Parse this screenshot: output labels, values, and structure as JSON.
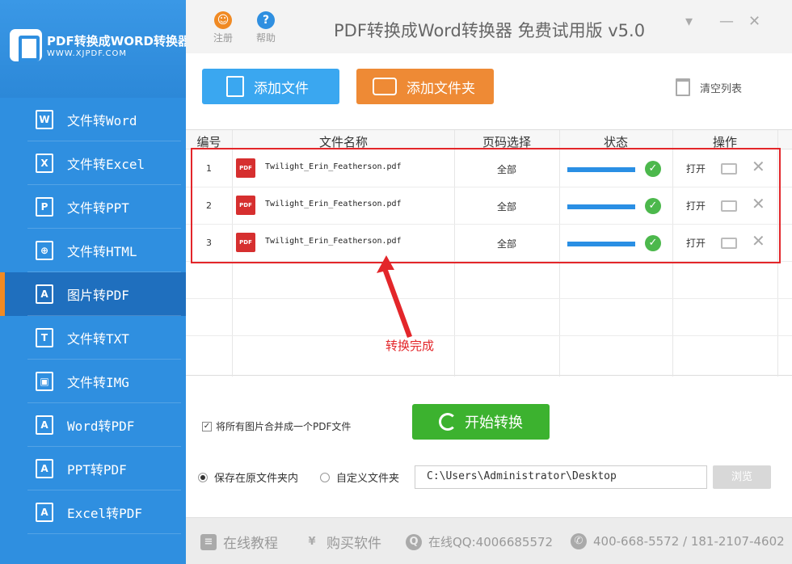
{
  "app": {
    "logo_title": "PDF转换成WORD转换器",
    "logo_sub": "WWW.XJPDF.COM",
    "title": "PDF转换成Word转换器 免费试用版 v5.0"
  },
  "topbar": {
    "register_label": "注册",
    "help_label": "帮助",
    "minimize": "▾",
    "min_bar": "—",
    "close": "✕"
  },
  "sidebar": {
    "items": [
      {
        "label": "文件转Word",
        "icon": "W",
        "active": false
      },
      {
        "label": "文件转Excel",
        "icon": "X",
        "active": false
      },
      {
        "label": "文件转PPT",
        "icon": "P",
        "active": false
      },
      {
        "label": "文件转HTML",
        "icon": "⊕",
        "active": false
      },
      {
        "label": "图片转PDF",
        "icon": "A",
        "active": true
      },
      {
        "label": "文件转TXT",
        "icon": "T",
        "active": false
      },
      {
        "label": "文件转IMG",
        "icon": "▣",
        "active": false
      },
      {
        "label": "Word转PDF",
        "icon": "A",
        "active": false
      },
      {
        "label": "PPT转PDF",
        "icon": "A",
        "active": false
      },
      {
        "label": "Excel转PDF",
        "icon": "A",
        "active": false
      }
    ]
  },
  "toolbar": {
    "add_file": "添加文件",
    "add_folder": "添加文件夹",
    "clear_list": "清空列表"
  },
  "table": {
    "headers": [
      "编号",
      "文件名称",
      "页码选择",
      "状态",
      "操作"
    ],
    "rows": [
      {
        "num": "1",
        "file": "Twilight_Erin_Featherson.pdf",
        "pages": "全部",
        "progress": 1.0,
        "action": "打开"
      },
      {
        "num": "2",
        "file": "Twilight_Erin_Featherson.pdf",
        "pages": "全部",
        "progress": 1.0,
        "action": "打开"
      },
      {
        "num": "3",
        "file": "Twilight_Erin_Featherson.pdf",
        "pages": "全部",
        "progress": 1.0,
        "action": "打开"
      }
    ],
    "pdf_badge": "PDF"
  },
  "annotation": {
    "note": "转换完成",
    "color": "#e3262a"
  },
  "options": {
    "merge_label": "将所有图片合并成一个PDF文件",
    "merge_checked": true,
    "start_button": "开始转换",
    "save_original": "保存在原文件夹内",
    "save_custom": "自定义文件夹",
    "path_value": "C:\\Users\\Administrator\\Desktop",
    "browse": "浏览"
  },
  "footer": {
    "tutorial": "在线教程",
    "buy": "购买软件",
    "qq": "在线QQ:4006685572",
    "phone": "400-668-5572 / 181-2107-4602"
  }
}
